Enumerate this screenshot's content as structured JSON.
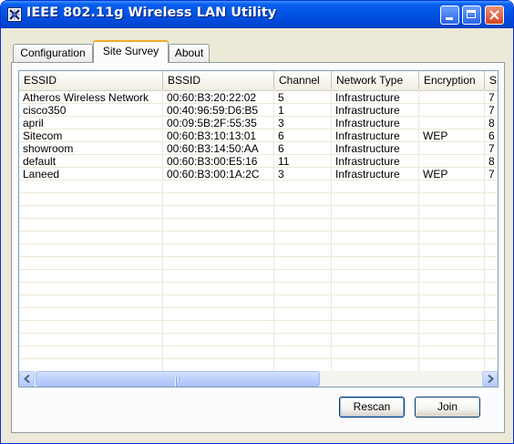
{
  "window": {
    "title": "IEEE 802.11g Wireless LAN Utility",
    "app_icon": "wireless-app-icon",
    "controls": [
      "minimize-icon",
      "maximize-icon",
      "close-icon"
    ]
  },
  "tabs": [
    {
      "label": "Configuration",
      "active": false
    },
    {
      "label": "Site Survey",
      "active": true
    },
    {
      "label": "About",
      "active": false
    }
  ],
  "table": {
    "columns": [
      "ESSID",
      "BSSID",
      "Channel",
      "Network Type",
      "Encryption",
      "S"
    ],
    "rows": [
      [
        "Atheros Wireless Network",
        "00:60:B3:20:22:02",
        "5",
        "Infrastructure",
        "",
        "7"
      ],
      [
        "cisco350",
        "00:40:96:59:D6:B5",
        "1",
        "Infrastructure",
        "",
        "7"
      ],
      [
        "april",
        "00:09:5B:2F:55:35",
        "3",
        "Infrastructure",
        "",
        "8"
      ],
      [
        "Sitecom",
        "00:60:B3:10:13:01",
        "6",
        "Infrastructure",
        "WEP",
        "6"
      ],
      [
        "showroom",
        "00:60:B3:14:50:AA",
        "6",
        "Infrastructure",
        "",
        "7"
      ],
      [
        "default",
        "00:60:B3:00:E5:16",
        "11",
        "Infrastructure",
        "",
        "8"
      ],
      [
        "Laneed",
        "00:60:B3:00:1A:2C",
        "3",
        "Infrastructure",
        "WEP",
        "7"
      ]
    ]
  },
  "buttons": {
    "rescan": "Rescan",
    "join": "Join"
  },
  "colors": {
    "titlebar": "#0054e3",
    "window_bg": "#ece9d8",
    "tab_highlight": "#f4a92c"
  }
}
